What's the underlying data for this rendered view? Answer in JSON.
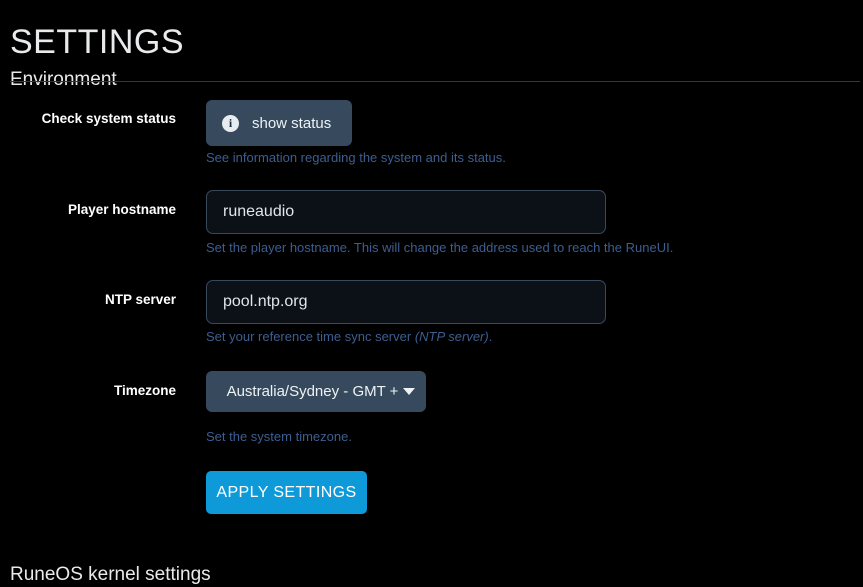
{
  "page": {
    "title": "SETTINGS",
    "bottom_section_heading": "RuneOS kernel settings"
  },
  "section": {
    "heading": "Environment"
  },
  "colors": {
    "background": "#000000",
    "accent_blue": "#0e9ad9",
    "slate_button": "#36495d",
    "help_text": "#3d5e91",
    "input_background": "#0c1117",
    "input_border": "#39495c",
    "rule": "#2b3a4a",
    "label_text": "#ffffff"
  },
  "rows": {
    "system_status": {
      "label": "Check system status",
      "button_label": "show status",
      "icon": "info-icon",
      "help": "See information regarding the system and its status."
    },
    "player_hostname": {
      "label": "Player hostname",
      "value": "runeaudio",
      "placeholder": "runeaudio",
      "help": "Set the player hostname. This will change the address used to reach the RuneUI."
    },
    "ntp_server": {
      "label": "NTP server",
      "value": "pool.ntp.org",
      "placeholder": "pool.ntp.org",
      "help_main": "Set your reference time sync server ",
      "help_em": "(NTP server)",
      "help_tail": "."
    },
    "timezone": {
      "label": "Timezone",
      "value": "Australia/Sydney - GMT +",
      "caret": "chevron-down-icon",
      "help": "Set the system timezone."
    }
  },
  "actions": {
    "apply_label": "APPLY SETTINGS"
  }
}
